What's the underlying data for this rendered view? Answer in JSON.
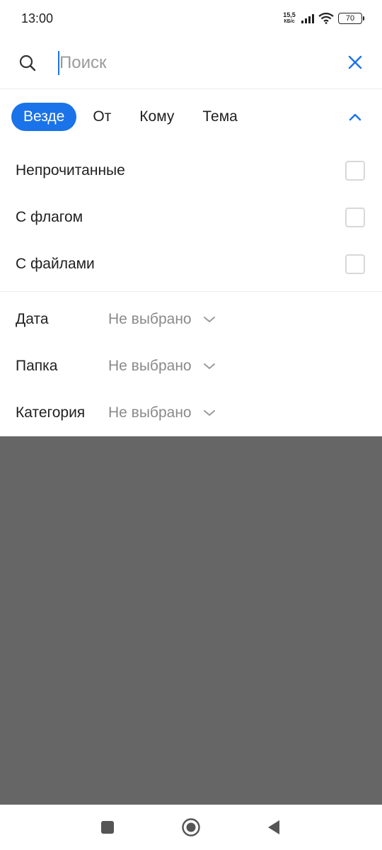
{
  "status_bar": {
    "time": "13:00",
    "net_speed_value": "15,5",
    "net_speed_unit": "КБ/с",
    "battery": "70"
  },
  "search": {
    "placeholder": "Поиск",
    "value": ""
  },
  "tabs": [
    {
      "label": "Везде",
      "active": true
    },
    {
      "label": "От",
      "active": false
    },
    {
      "label": "Кому",
      "active": false
    },
    {
      "label": "Тема",
      "active": false
    }
  ],
  "filters": {
    "checkboxes": [
      {
        "label": "Непрочитанные",
        "checked": false
      },
      {
        "label": "С флагом",
        "checked": false
      },
      {
        "label": "С файлами",
        "checked": false
      }
    ],
    "selects": [
      {
        "label": "Дата",
        "value": "Не выбрано"
      },
      {
        "label": "Папка",
        "value": "Не выбрано"
      },
      {
        "label": "Категория",
        "value": "Не выбрано"
      }
    ]
  },
  "colors": {
    "accent": "#1a73e8",
    "overlay": "#666666"
  },
  "icons": {
    "search": "search-icon",
    "close": "close-icon",
    "collapse": "chevron-up-icon",
    "dropdown": "chevron-down-icon",
    "nav_recents": "square-icon",
    "nav_home": "circle-icon",
    "nav_back": "triangle-back-icon"
  }
}
